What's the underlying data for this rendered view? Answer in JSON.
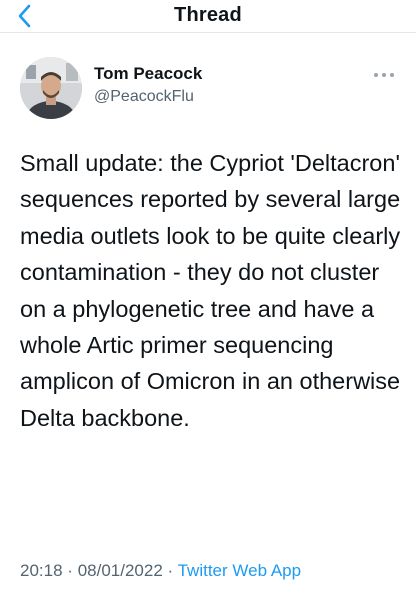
{
  "header": {
    "title": "Thread",
    "back_icon": "chevron-left-icon"
  },
  "tweet": {
    "author_name": "Tom Peacock",
    "author_handle": "@PeacockFlu",
    "text": "Small update: the Cypriot 'Deltacron' sequences reported by several large media outlets look to be quite clearly contamination - they do not cluster on a phylogenetic tree and have a whole Artic primer sequencing amplicon of Omicron in an otherwise Delta backbone.",
    "time": "20:18",
    "separator": "·",
    "date": "08/01/2022",
    "app": "Twitter Web App",
    "more_icon": "more-horizontal-icon"
  },
  "colors": {
    "accent": "#1d9bf0",
    "text_primary": "#0f1419",
    "text_secondary": "#536471",
    "divider": "#e3e6ea"
  }
}
